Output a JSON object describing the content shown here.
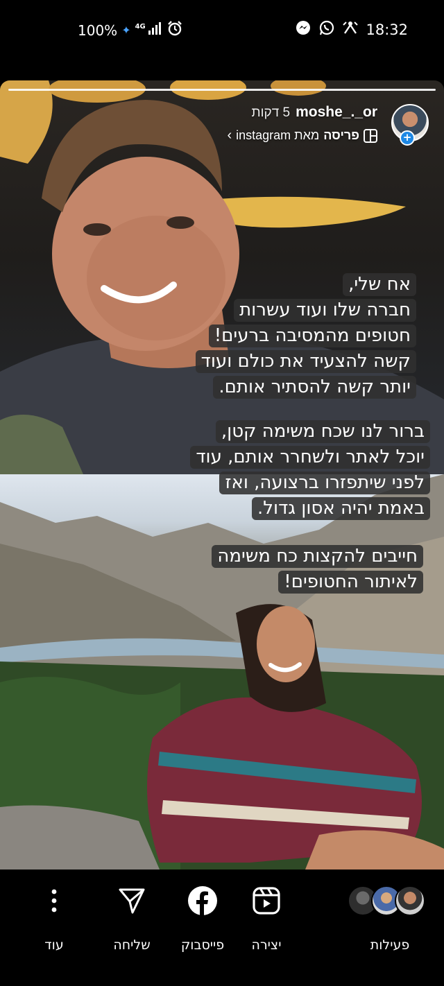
{
  "status_bar": {
    "battery": "100%",
    "network": "4G",
    "time": "18:32",
    "icons": [
      "battery-saver-icon",
      "signal-icon",
      "alarm-icon",
      "messenger-icon",
      "whatsapp-icon",
      "rotate-icon"
    ]
  },
  "story": {
    "username": "moshe_._or",
    "time_ago": "5 דקות",
    "source_prefix": "פריסה",
    "source_text": "מאת instagram",
    "caption_blocks": [
      [
        "אח שלי,",
        "חברה שלו ועוד עשרות",
        "חטופים מהמסיבה ברעים!",
        "קשה להצעיד את כולם ועוד",
        "יותר קשה להסתיר אותם."
      ],
      [
        "ברור לנו שכח משימה קטן,",
        "יוכל לאתר ולשחרר אותם, עוד",
        "לפני שיתפזרו ברצועה, ואז",
        "באמת יהיה אסון גדול."
      ],
      [
        "חייבים להקצות כח משימה",
        "לאיתור החטופים!"
      ]
    ]
  },
  "actions": [
    {
      "label": "עוד",
      "icon": "more-icon"
    },
    {
      "label": "שליחה",
      "icon": "send-icon"
    },
    {
      "label": "פייסבוק",
      "icon": "facebook-icon"
    },
    {
      "label": "יצירה",
      "icon": "reels-icon"
    },
    {
      "label": "פעילות",
      "icon": "activity-avatars"
    }
  ]
}
